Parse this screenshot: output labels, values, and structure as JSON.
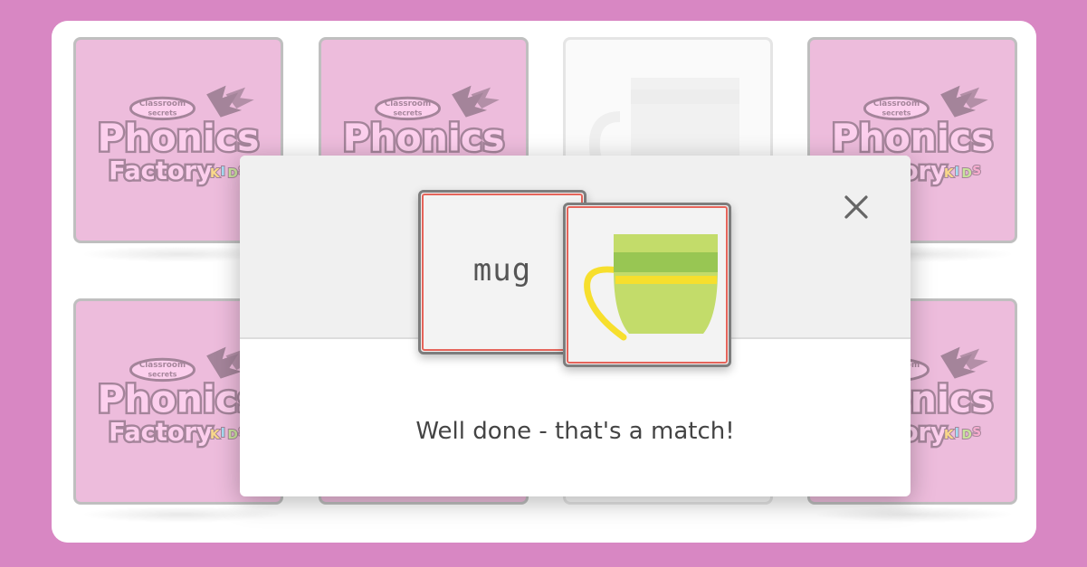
{
  "game": {
    "card_back": {
      "brand_small": "Classroom secrets",
      "brand_main": "Phonics",
      "brand_sub": "Factory",
      "brand_badge": "KIDS"
    }
  },
  "match_modal": {
    "word": "mug",
    "picture_icon": "mug-icon",
    "message": "Well done - that's a match!",
    "close_icon": "close-icon"
  },
  "colors": {
    "page_bg": "#d887c3",
    "card_back": "#de85bf",
    "logo_pink": "#f9a8de",
    "logo_outline": "#5a1f47",
    "card_highlight": "#e5645a",
    "mug_green": "#c3dc6a",
    "mug_stripe_dark": "#98c653",
    "mug_stripe_yellow": "#f7df2d"
  }
}
